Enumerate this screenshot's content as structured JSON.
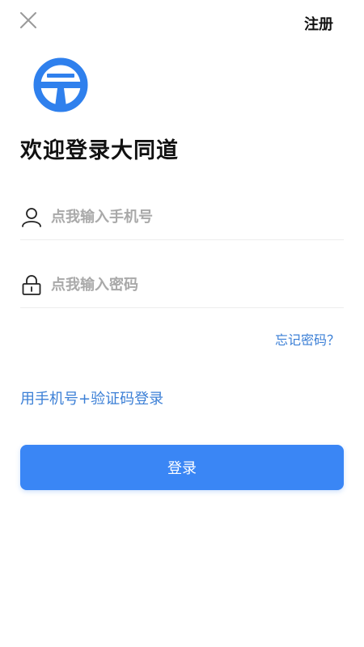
{
  "header": {
    "close_icon": "close-icon",
    "register_label": "注册"
  },
  "brand": {
    "logo_icon": "datongdao-logo",
    "logo_color": "#2f80ed",
    "welcome_title": "欢迎登录大同道"
  },
  "form": {
    "phone": {
      "icon": "user-icon",
      "placeholder": "点我输入手机号",
      "value": ""
    },
    "password": {
      "icon": "lock-icon",
      "placeholder": "点我输入密码",
      "value": ""
    },
    "forgot_password_label": "忘记密码？",
    "sms_login_label": "用手机号+验证码登录",
    "login_button_label": "登录"
  },
  "colors": {
    "accent": "#3a86f5",
    "link": "#3b7fd6"
  }
}
